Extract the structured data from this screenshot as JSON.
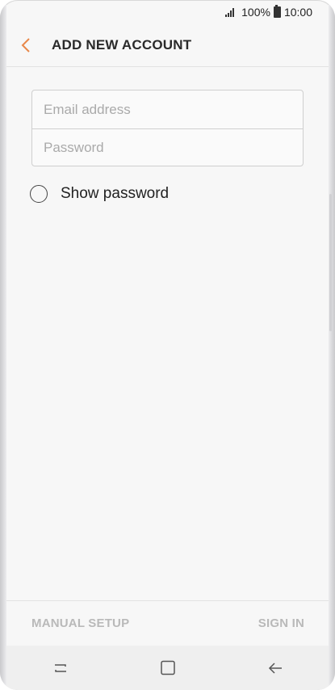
{
  "status_bar": {
    "battery": "100%",
    "time": "10:00"
  },
  "header": {
    "title": "ADD NEW ACCOUNT"
  },
  "form": {
    "email_placeholder": "Email address",
    "password_placeholder": "Password"
  },
  "show_password": {
    "label": "Show password",
    "checked": false
  },
  "bottom_actions": {
    "manual_setup_label": "MANUAL SETUP",
    "sign_in_label": "SIGN IN"
  },
  "colors": {
    "accent": "#e8884a",
    "disabled_text": "#b9b9b9"
  }
}
